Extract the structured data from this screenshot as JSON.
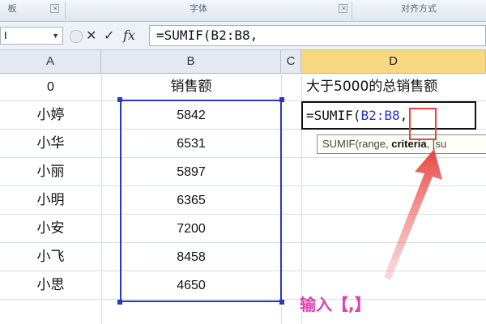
{
  "ribbon": {
    "groups": [
      {
        "label": "板",
        "launcher": "⇲"
      },
      {
        "label": "字体",
        "launcher": "⇲"
      },
      {
        "label": "对齐方式"
      }
    ]
  },
  "formula_bar": {
    "name_box": "I",
    "name_box_arrow": "▼",
    "cancel_symbol": "✕",
    "enter_symbol": "✓",
    "fx_symbol": "fx",
    "formula": "=SUMIF(B2:B8,"
  },
  "columns": [
    "A",
    "B",
    "C",
    "D"
  ],
  "rows": [
    {
      "a": "0",
      "b": "销售额"
    },
    {
      "a": "小婷",
      "b": "5842"
    },
    {
      "a": "小华",
      "b": "6531"
    },
    {
      "a": "小丽",
      "b": "5897"
    },
    {
      "a": "小明",
      "b": "6365"
    },
    {
      "a": "小安",
      "b": "7200"
    },
    {
      "a": "小飞",
      "b": "8458"
    },
    {
      "a": "小思",
      "b": "4650"
    }
  ],
  "d_header_cell": "大于5000的总销售额",
  "edit_cell": {
    "prefix": "=SUMIF(",
    "ref": "B2:B8",
    "suffix": ","
  },
  "tooltip": {
    "func": "SUMIF(range, ",
    "bold_arg": "criteria",
    "rest": ", [su"
  },
  "annotation": "输入【,】",
  "colors": {
    "range_border": "#2a35c9",
    "highlight_box": "#e6453f",
    "annotation": "#e03fb5",
    "active_col": "#f7d77f"
  }
}
